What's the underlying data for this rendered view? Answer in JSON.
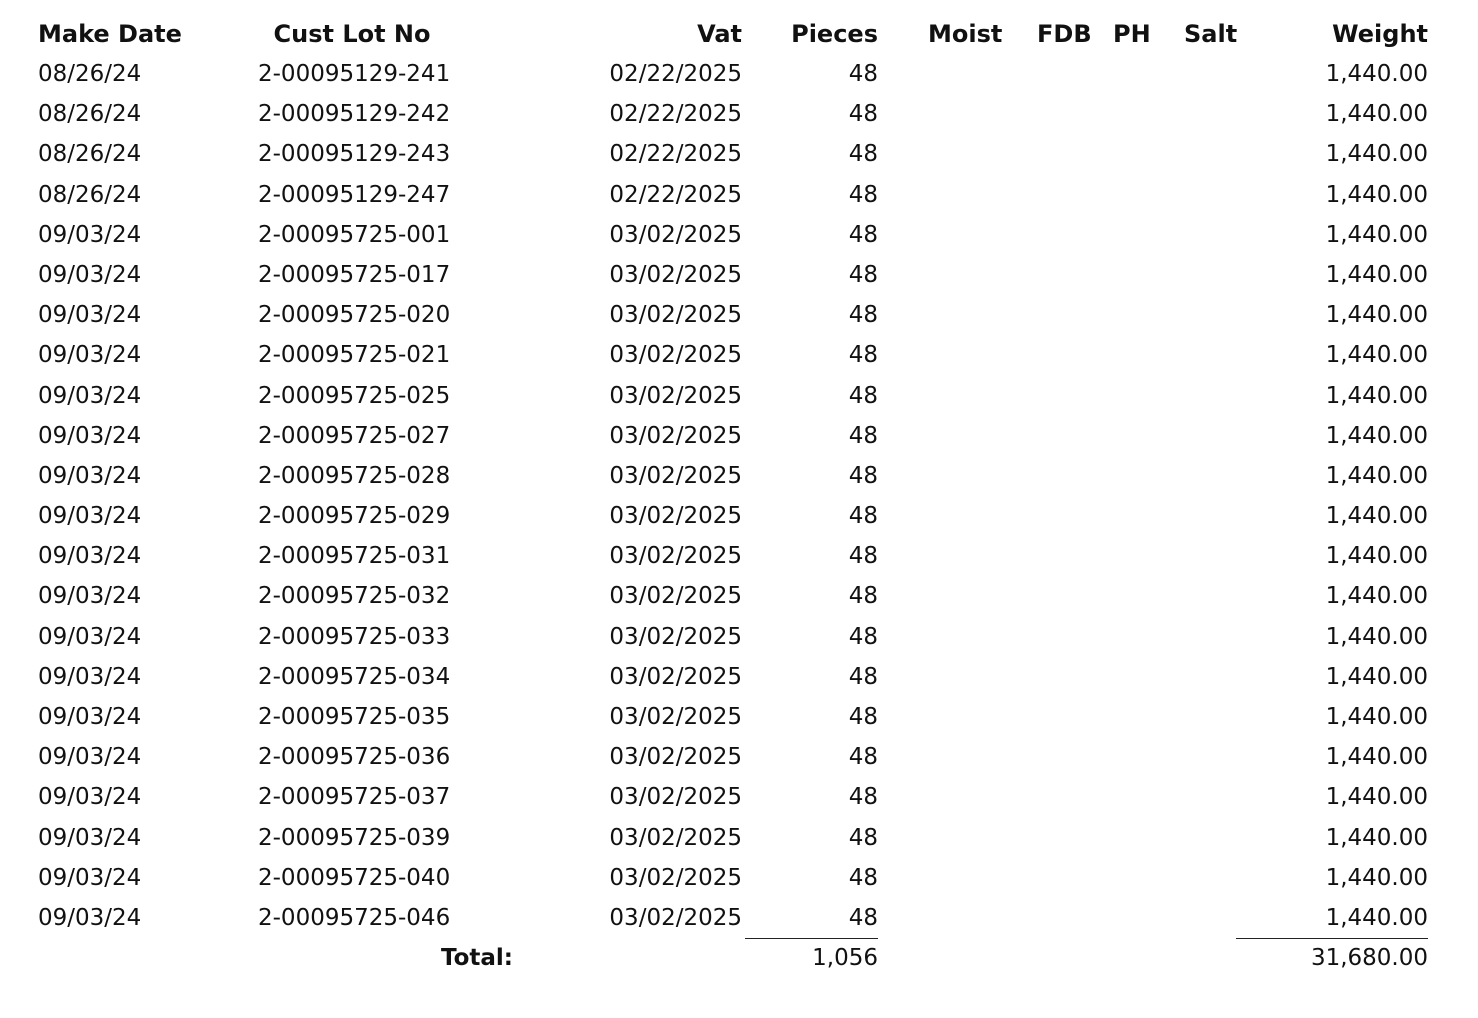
{
  "columns": {
    "make_date": "Make Date",
    "cust_lot_no": "Cust Lot No",
    "vat": "Vat",
    "pieces": "Pieces",
    "moist": "Moist",
    "fdb": "FDB",
    "ph": "PH",
    "salt": "Salt",
    "weight": "Weight"
  },
  "rows": [
    {
      "make_date": "08/26/24",
      "cust_lot_no": "2-00095129-241",
      "vat": "02/22/2025",
      "pieces": "48",
      "weight": "1,440.00"
    },
    {
      "make_date": "08/26/24",
      "cust_lot_no": "2-00095129-242",
      "vat": "02/22/2025",
      "pieces": "48",
      "weight": "1,440.00"
    },
    {
      "make_date": "08/26/24",
      "cust_lot_no": "2-00095129-243",
      "vat": "02/22/2025",
      "pieces": "48",
      "weight": "1,440.00"
    },
    {
      "make_date": "08/26/24",
      "cust_lot_no": "2-00095129-247",
      "vat": "02/22/2025",
      "pieces": "48",
      "weight": "1,440.00"
    },
    {
      "make_date": "09/03/24",
      "cust_lot_no": "2-00095725-001",
      "vat": "03/02/2025",
      "pieces": "48",
      "weight": "1,440.00"
    },
    {
      "make_date": "09/03/24",
      "cust_lot_no": "2-00095725-017",
      "vat": "03/02/2025",
      "pieces": "48",
      "weight": "1,440.00"
    },
    {
      "make_date": "09/03/24",
      "cust_lot_no": "2-00095725-020",
      "vat": "03/02/2025",
      "pieces": "48",
      "weight": "1,440.00"
    },
    {
      "make_date": "09/03/24",
      "cust_lot_no": "2-00095725-021",
      "vat": "03/02/2025",
      "pieces": "48",
      "weight": "1,440.00"
    },
    {
      "make_date": "09/03/24",
      "cust_lot_no": "2-00095725-025",
      "vat": "03/02/2025",
      "pieces": "48",
      "weight": "1,440.00"
    },
    {
      "make_date": "09/03/24",
      "cust_lot_no": "2-00095725-027",
      "vat": "03/02/2025",
      "pieces": "48",
      "weight": "1,440.00"
    },
    {
      "make_date": "09/03/24",
      "cust_lot_no": "2-00095725-028",
      "vat": "03/02/2025",
      "pieces": "48",
      "weight": "1,440.00"
    },
    {
      "make_date": "09/03/24",
      "cust_lot_no": "2-00095725-029",
      "vat": "03/02/2025",
      "pieces": "48",
      "weight": "1,440.00"
    },
    {
      "make_date": "09/03/24",
      "cust_lot_no": "2-00095725-031",
      "vat": "03/02/2025",
      "pieces": "48",
      "weight": "1,440.00"
    },
    {
      "make_date": "09/03/24",
      "cust_lot_no": "2-00095725-032",
      "vat": "03/02/2025",
      "pieces": "48",
      "weight": "1,440.00"
    },
    {
      "make_date": "09/03/24",
      "cust_lot_no": "2-00095725-033",
      "vat": "03/02/2025",
      "pieces": "48",
      "weight": "1,440.00"
    },
    {
      "make_date": "09/03/24",
      "cust_lot_no": "2-00095725-034",
      "vat": "03/02/2025",
      "pieces": "48",
      "weight": "1,440.00"
    },
    {
      "make_date": "09/03/24",
      "cust_lot_no": "2-00095725-035",
      "vat": "03/02/2025",
      "pieces": "48",
      "weight": "1,440.00"
    },
    {
      "make_date": "09/03/24",
      "cust_lot_no": "2-00095725-036",
      "vat": "03/02/2025",
      "pieces": "48",
      "weight": "1,440.00"
    },
    {
      "make_date": "09/03/24",
      "cust_lot_no": "2-00095725-037",
      "vat": "03/02/2025",
      "pieces": "48",
      "weight": "1,440.00"
    },
    {
      "make_date": "09/03/24",
      "cust_lot_no": "2-00095725-039",
      "vat": "03/02/2025",
      "pieces": "48",
      "weight": "1,440.00"
    },
    {
      "make_date": "09/03/24",
      "cust_lot_no": "2-00095725-040",
      "vat": "03/02/2025",
      "pieces": "48",
      "weight": "1,440.00"
    },
    {
      "make_date": "09/03/24",
      "cust_lot_no": "2-00095725-046",
      "vat": "03/02/2025",
      "pieces": "48",
      "weight": "1,440.00"
    }
  ],
  "totals": {
    "label": "Total:",
    "pieces": "1,056",
    "weight": "31,680.00"
  }
}
